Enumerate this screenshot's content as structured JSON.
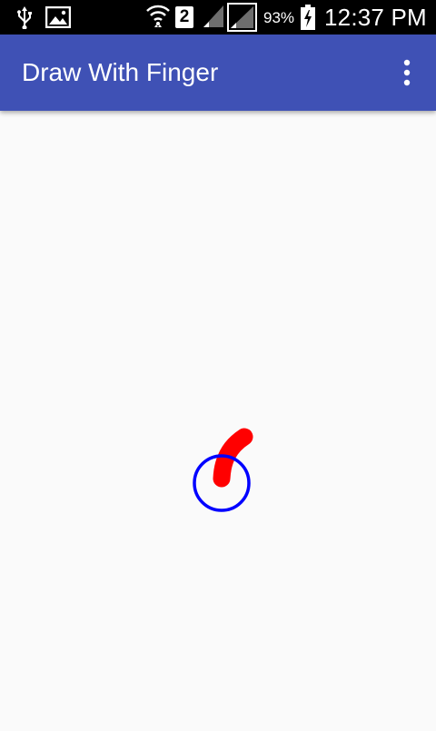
{
  "status_bar": {
    "icons_left": [
      "usb-icon",
      "image-notification-icon"
    ],
    "icons_right": [
      "wifi-icon",
      "sim-2-icon",
      "signal-icon",
      "signal-icon-2",
      "battery-icon"
    ],
    "sim_slot": "2",
    "battery_percent": "93%",
    "time": "12:37 PM"
  },
  "app_bar": {
    "title": "Draw With Finger",
    "overflow_icon": "more-vert-icon"
  },
  "colors": {
    "app_bar": "#3f51b5",
    "background": "#fafafa",
    "stroke": "#ff0000",
    "cursor_circle": "#0000ff"
  },
  "canvas": {
    "stroke_color_name": "red",
    "cursor_color_name": "blue"
  }
}
